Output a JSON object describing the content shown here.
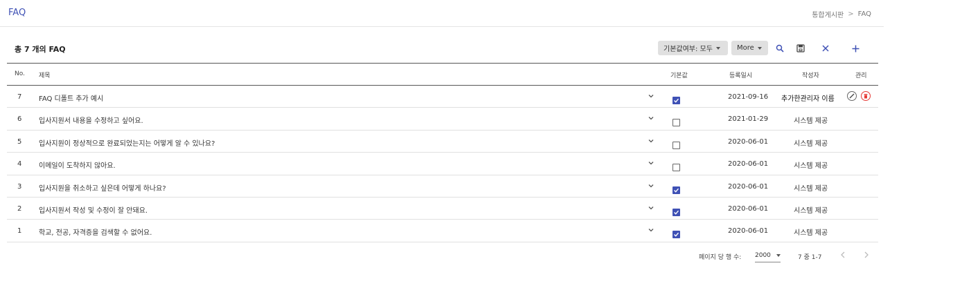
{
  "header": {
    "title": "FAQ",
    "breadcrumb": [
      "통합게시판",
      "FAQ"
    ]
  },
  "toolbar": {
    "count_label": "총 7 개의 FAQ",
    "default_filter_label": "기본값여부: 모두",
    "more_label": "More",
    "icons": [
      "search-icon",
      "save-icon",
      "close-icon",
      "add-icon"
    ],
    "accent_color": "#3f51b5"
  },
  "table": {
    "columns": [
      "No.",
      "제목",
      "기본값",
      "등록일시",
      "작성자",
      "관리"
    ],
    "rows": [
      {
        "no": "7",
        "title": "FAQ 디폴트 추가 예시",
        "default": true,
        "date": "2021-09-16",
        "author": "추가한관리자 이름",
        "actions": true
      },
      {
        "no": "6",
        "title": "입사지원서 내용을 수정하고 싶어요.",
        "default": false,
        "date": "2021-01-29",
        "author": "시스템 제공",
        "actions": false
      },
      {
        "no": "5",
        "title": "입사지원이 정상적으로 완료되었는지는 어떻게 알 수 있나요?",
        "default": false,
        "date": "2020-06-01",
        "author": "시스템 제공",
        "actions": false
      },
      {
        "no": "4",
        "title": "이메일이 도착하지 않아요.",
        "default": false,
        "date": "2020-06-01",
        "author": "시스템 제공",
        "actions": false
      },
      {
        "no": "3",
        "title": "입사지원을 취소하고 싶은데 어떻게 하나요?",
        "default": true,
        "date": "2020-06-01",
        "author": "시스템 제공",
        "actions": false
      },
      {
        "no": "2",
        "title": "입사지원서 작성 및 수정이 잘 안돼요.",
        "default": true,
        "date": "2020-06-01",
        "author": "시스템 제공",
        "actions": false
      },
      {
        "no": "1",
        "title": "학교, 전공, 자격증을 검색할 수 없어요.",
        "default": true,
        "date": "2020-06-01",
        "author": "시스템 제공",
        "actions": false
      }
    ]
  },
  "pagination": {
    "rows_per_page_label": "페이지 당 행 수:",
    "rows_per_page_value": "2000",
    "range_label": "7 중 1-7"
  }
}
